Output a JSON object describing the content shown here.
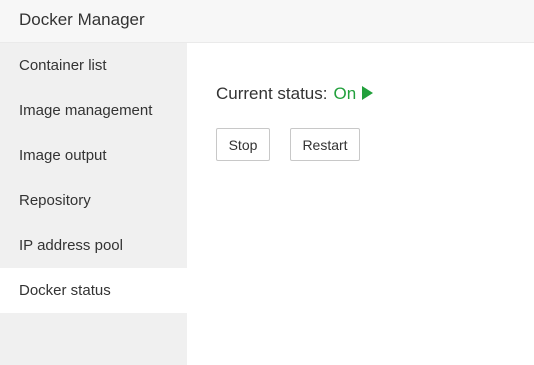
{
  "app": {
    "title": "Docker Manager"
  },
  "sidebar": {
    "items": [
      {
        "label": "Container list",
        "active": false
      },
      {
        "label": "Image management",
        "active": false
      },
      {
        "label": "Image output",
        "active": false
      },
      {
        "label": "Repository",
        "active": false
      },
      {
        "label": "IP address pool",
        "active": false
      },
      {
        "label": "Docker status",
        "active": true
      }
    ]
  },
  "status": {
    "label": "Current status:",
    "value": "On",
    "value_color": "#22a03c",
    "icon": "play-icon"
  },
  "actions": {
    "stop_label": "Stop",
    "restart_label": "Restart"
  }
}
